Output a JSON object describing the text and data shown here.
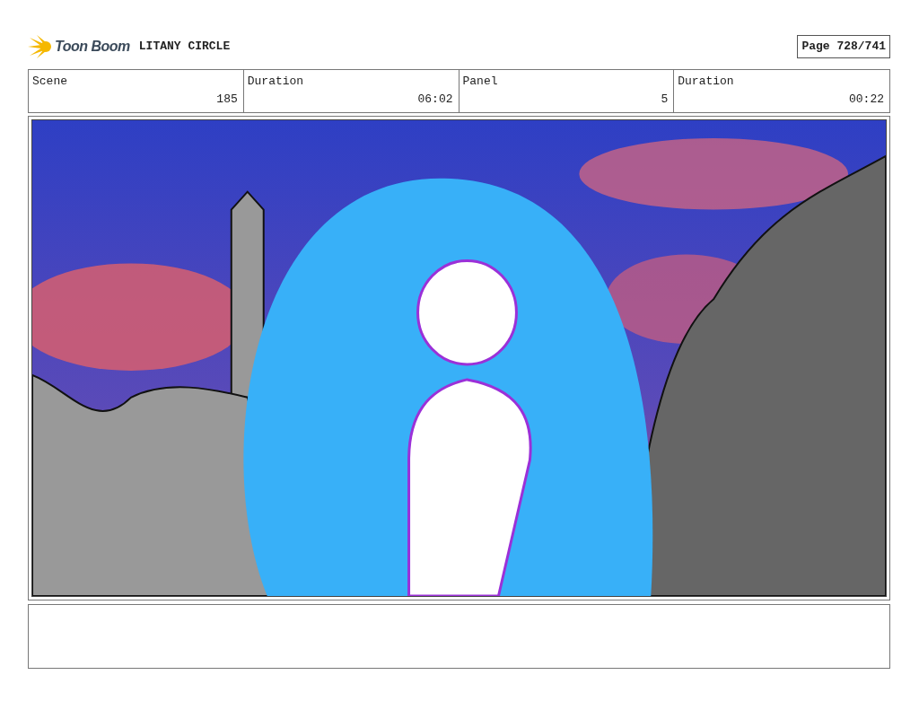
{
  "header": {
    "logo": "Toon Boom",
    "project_title": "LITANY CIRCLE",
    "page": "Page 728/741"
  },
  "info_table": {
    "columns": [
      "Scene",
      "Duration",
      "Panel",
      "Duration"
    ],
    "values": [
      "185",
      "06:02",
      "5",
      "00:22"
    ]
  }
}
